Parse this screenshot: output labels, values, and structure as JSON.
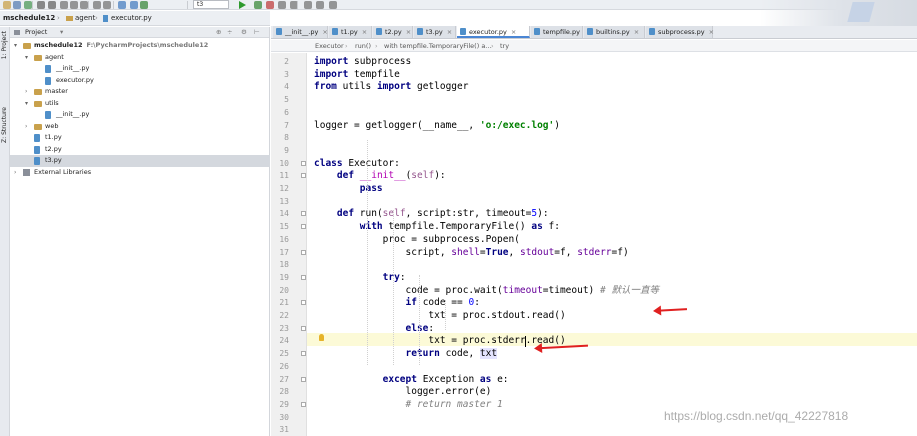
{
  "toolbar": {
    "run_config": "t3",
    "icons": [
      "folder-open-icon",
      "save-icon",
      "sync-icon",
      "back-icon",
      "forward-icon",
      "cut-icon",
      "copy-icon",
      "paste-icon",
      "find-icon",
      "replace-icon",
      "back-nav-icon",
      "forward-nav-icon",
      "build-icon",
      "run-icon",
      "debug-icon",
      "stop-icon",
      "coverage-icon",
      "vcs-icon",
      "settings-icon",
      "sdk-icon",
      "help-icon"
    ]
  },
  "navbar": {
    "crumbs": [
      "mschedule12",
      "agent",
      "executor.py"
    ]
  },
  "left_strip": {
    "project_tab": "1: Project",
    "structure_tab": "Z: Structure"
  },
  "project_panel": {
    "title": "Project",
    "tree": [
      {
        "label": "mschedule12",
        "path": "F:\\PycharmProjects\\mschedule12",
        "kind": "folder",
        "depth": 0,
        "open": true,
        "bold": true
      },
      {
        "label": "agent",
        "kind": "folder",
        "depth": 1,
        "open": true
      },
      {
        "label": "__init__.py",
        "kind": "py",
        "depth": 2
      },
      {
        "label": "executor.py",
        "kind": "py",
        "depth": 2
      },
      {
        "label": "master",
        "kind": "folder",
        "depth": 1,
        "open": false
      },
      {
        "label": "utils",
        "kind": "folder",
        "depth": 1,
        "open": true
      },
      {
        "label": "__init__.py",
        "kind": "py",
        "depth": 2
      },
      {
        "label": "web",
        "kind": "folder",
        "depth": 1,
        "open": false
      },
      {
        "label": "t1.py",
        "kind": "py",
        "depth": 1
      },
      {
        "label": "t2.py",
        "kind": "py",
        "depth": 1
      },
      {
        "label": "t3.py",
        "kind": "py",
        "depth": 1,
        "selected": true
      },
      {
        "label": "External Libraries",
        "kind": "lib",
        "depth": 0,
        "open": false
      }
    ]
  },
  "tabs": [
    {
      "label": "__init__.py",
      "active": false
    },
    {
      "label": "t1.py",
      "active": false
    },
    {
      "label": "t2.py",
      "active": false
    },
    {
      "label": "t3.py",
      "active": false
    },
    {
      "label": "executor.py",
      "active": true
    },
    {
      "label": "tempfile.py",
      "active": false
    },
    {
      "label": "builtins.py",
      "active": false
    },
    {
      "label": "subprocess.py",
      "active": false
    }
  ],
  "editor_breadcrumb": [
    "Executor",
    "run()",
    "with tempfile.TemporaryFile() a...",
    "try"
  ],
  "code": {
    "current_line": 24,
    "lines": [
      {
        "n": 2,
        "tokens": [
          [
            "kw",
            "import"
          ],
          [
            "p",
            " subprocess"
          ]
        ]
      },
      {
        "n": 3,
        "tokens": [
          [
            "kw",
            "import"
          ],
          [
            "p",
            " tempfile"
          ]
        ]
      },
      {
        "n": 4,
        "tokens": [
          [
            "kw",
            "from"
          ],
          [
            "p",
            " utils "
          ],
          [
            "kw",
            "import"
          ],
          [
            "p",
            " getlogger"
          ]
        ]
      },
      {
        "n": 5,
        "tokens": []
      },
      {
        "n": 6,
        "tokens": []
      },
      {
        "n": 7,
        "tokens": [
          [
            "p",
            "logger = getlogger(__name__, "
          ],
          [
            "str",
            "'o:/exec.log'"
          ],
          [
            "p",
            ")"
          ]
        ]
      },
      {
        "n": 8,
        "tokens": []
      },
      {
        "n": 9,
        "tokens": []
      },
      {
        "n": 10,
        "tokens": [
          [
            "kw",
            "class"
          ],
          [
            "p",
            " Executor:"
          ]
        ]
      },
      {
        "n": 11,
        "tokens": [
          [
            "p",
            "    "
          ],
          [
            "kw",
            "def"
          ],
          [
            "p",
            " "
          ],
          [
            "fn",
            "__init__"
          ],
          [
            "p",
            "("
          ],
          [
            "self",
            "self"
          ],
          [
            "p",
            "):"
          ]
        ]
      },
      {
        "n": 12,
        "tokens": [
          [
            "p",
            "        "
          ],
          [
            "kw",
            "pass"
          ]
        ]
      },
      {
        "n": 13,
        "tokens": []
      },
      {
        "n": 14,
        "tokens": [
          [
            "p",
            "    "
          ],
          [
            "kw",
            "def"
          ],
          [
            "p",
            " run("
          ],
          [
            "self",
            "self"
          ],
          [
            "p",
            ", script:str, timeout="
          ],
          [
            "num",
            "5"
          ],
          [
            "p",
            "):"
          ]
        ]
      },
      {
        "n": 15,
        "tokens": [
          [
            "p",
            "        "
          ],
          [
            "kw",
            "with"
          ],
          [
            "p",
            " tempfile.TemporaryFile() "
          ],
          [
            "kw",
            "as"
          ],
          [
            "p",
            " f:"
          ]
        ]
      },
      {
        "n": 16,
        "tokens": [
          [
            "p",
            "            proc = subprocess.Popen("
          ]
        ]
      },
      {
        "n": 17,
        "tokens": [
          [
            "p",
            "                script, "
          ],
          [
            "param",
            "shell"
          ],
          [
            "p",
            "="
          ],
          [
            "kw",
            "True"
          ],
          [
            "p",
            ", "
          ],
          [
            "param",
            "stdout"
          ],
          [
            "p",
            "=f, "
          ],
          [
            "param",
            "stderr"
          ],
          [
            "p",
            "=f)"
          ]
        ]
      },
      {
        "n": 18,
        "tokens": []
      },
      {
        "n": 19,
        "tokens": [
          [
            "p",
            "            "
          ],
          [
            "kw",
            "try"
          ],
          [
            "p",
            ":"
          ]
        ]
      },
      {
        "n": 20,
        "tokens": [
          [
            "p",
            "                code = proc.wait("
          ],
          [
            "param",
            "timeout"
          ],
          [
            "p",
            "=timeout) "
          ],
          [
            "cm",
            "# 默认一直等"
          ]
        ]
      },
      {
        "n": 21,
        "tokens": [
          [
            "p",
            "                "
          ],
          [
            "kw",
            "if"
          ],
          [
            "p",
            " code == "
          ],
          [
            "num",
            "0"
          ],
          [
            "p",
            ":"
          ]
        ]
      },
      {
        "n": 22,
        "tokens": [
          [
            "p",
            "                    txt = proc.stdout.read()"
          ]
        ]
      },
      {
        "n": 23,
        "tokens": [
          [
            "p",
            "                "
          ],
          [
            "kw",
            "else"
          ],
          [
            "p",
            ":"
          ]
        ]
      },
      {
        "n": 24,
        "tokens": [
          [
            "p",
            "                    txt = proc.stderr.read()"
          ]
        ]
      },
      {
        "n": 25,
        "tokens": [
          [
            "p",
            "                "
          ],
          [
            "kw",
            "return"
          ],
          [
            "p",
            " code, "
          ],
          [
            "hl",
            "txt"
          ]
        ]
      },
      {
        "n": 26,
        "tokens": []
      },
      {
        "n": 27,
        "tokens": [
          [
            "p",
            "            "
          ],
          [
            "kw",
            "except"
          ],
          [
            "p",
            " Exception "
          ],
          [
            "kw",
            "as"
          ],
          [
            "p",
            " e:"
          ]
        ]
      },
      {
        "n": 28,
        "tokens": [
          [
            "p",
            "                logger.error(e)"
          ]
        ]
      },
      {
        "n": 29,
        "tokens": [
          [
            "p",
            "                "
          ],
          [
            "cm",
            "# return master 1"
          ]
        ]
      },
      {
        "n": 30,
        "tokens": []
      },
      {
        "n": 31,
        "tokens": []
      }
    ]
  },
  "watermark": "https://blog.csdn.net/qq_42227818",
  "colors": {
    "annotation_arrow": "#e02020",
    "active_tab_underline": "#4a86d4",
    "current_line": "#fcfad7"
  }
}
